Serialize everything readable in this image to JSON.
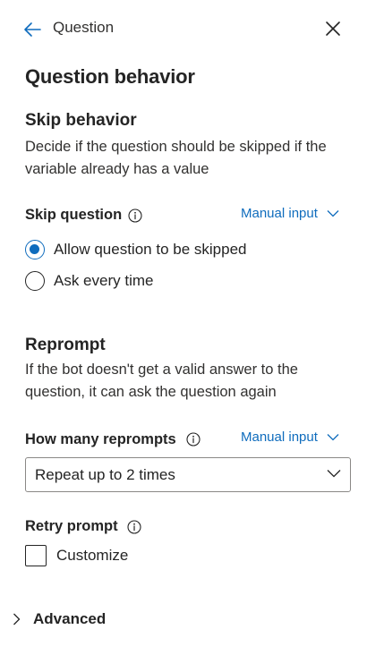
{
  "header": {
    "title": "Question",
    "back_icon": "arrow-left-icon",
    "close_icon": "close-icon"
  },
  "page_title": "Question behavior",
  "skip": {
    "heading": "Skip behavior",
    "description": "Decide if the question should be skipped if the variable already has a value",
    "label": "Skip question",
    "mode": "Manual input",
    "options": [
      {
        "label": "Allow question to be skipped",
        "selected": true
      },
      {
        "label": "Ask every time",
        "selected": false
      }
    ]
  },
  "reprompt": {
    "heading": "Reprompt",
    "description": "If the bot doesn't get a valid answer to the question, it can ask the question again",
    "label": "How many reprompts",
    "mode": "Manual input",
    "select_value": "Repeat up to 2 times"
  },
  "retry": {
    "label": "Retry prompt",
    "checkbox_label": "Customize",
    "checked": false
  },
  "advanced": {
    "label": "Advanced"
  },
  "colors": {
    "accent": "#0f6cbd",
    "text": "#242424"
  }
}
